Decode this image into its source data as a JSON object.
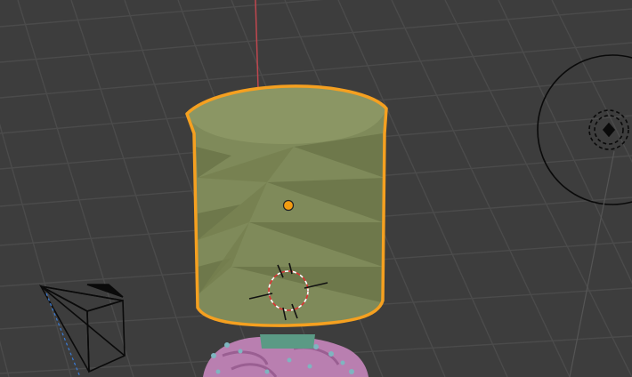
{
  "app": "3D viewport",
  "viewport": {
    "background": "#3d3d3d",
    "grid_color": "#4a4a4a",
    "axis_color": "#c0474f",
    "selection_outline_color": "#f5a020",
    "origin_color": "#f39c12"
  },
  "objects": [
    {
      "name": "cylinder-object",
      "selected": true,
      "color": "#7f8a5a"
    },
    {
      "name": "sculpted-base-object",
      "selected": false,
      "color": "#b97fb0"
    },
    {
      "name": "camera-object",
      "selected": false
    },
    {
      "name": "light-object",
      "selected": false
    }
  ],
  "tools": {
    "3d_cursor": "3d-cursor-icon",
    "origin": "origin-point-icon"
  }
}
